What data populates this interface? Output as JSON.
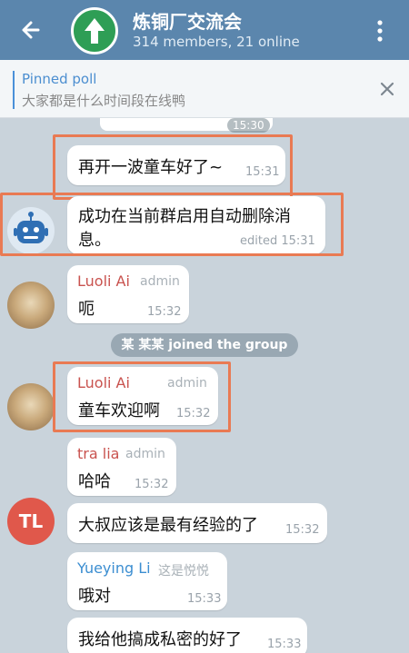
{
  "header": {
    "back_icon": "arrow-left-icon",
    "title": "炼铜厂交流会",
    "subtitle": "314 members, 21 online",
    "menu_icon": "more-vertical-icon",
    "avatar_icon": "up-arrow-icon",
    "color": "#5b86ad"
  },
  "pinned": {
    "title": "Pinned poll",
    "text": "大家都是什么时间段在线鸭",
    "close_icon": "close-icon"
  },
  "top_timestamp": "15:30",
  "messages": [
    {
      "text": "再开一波童车好了~",
      "time": "15:31"
    },
    {
      "text_line1": "成功在当前群启用自动删除消",
      "text_line2": "息。",
      "time": "edited 15:31"
    },
    {
      "sender": "Luoli Ai",
      "role": "admin",
      "text": "呃",
      "time": "15:32"
    },
    {
      "system_text": "某 某某 joined the group"
    },
    {
      "sender": "Luoli Ai",
      "role": "admin",
      "text": "童车欢迎啊",
      "time": "15:32"
    },
    {
      "sender": "tra lia",
      "role": "admin",
      "text": "哈哈",
      "time": "15:32"
    },
    {
      "avatar_initials": "TL",
      "text": "大叔应该是最有经验的了",
      "time": "15:32"
    },
    {
      "sender": "Yueying Li",
      "role": "这是悦悦",
      "text": "哦对",
      "time": "15:33"
    },
    {
      "text": "我给他搞成私密的好了",
      "time": "15:33"
    }
  ],
  "highlight_color": "#e97a53"
}
